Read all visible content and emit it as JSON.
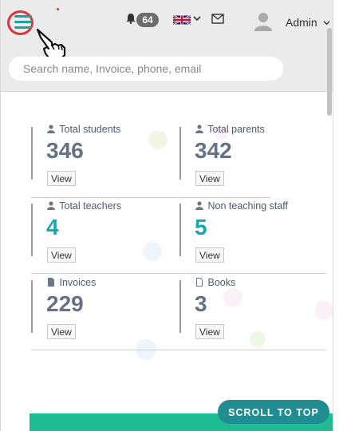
{
  "header": {
    "notification_count": "64",
    "user_name": "Admin",
    "dropdown_caret": "⌵"
  },
  "search": {
    "placeholder": "Search name, Invoice, phone, email"
  },
  "stats": [
    {
      "label": "Total students",
      "value": "346",
      "view_label": "View",
      "icon": "user-icon",
      "value_color": "#637287"
    },
    {
      "label": "Total parents",
      "value": "342",
      "view_label": "View",
      "icon": "user-icon",
      "value_color": "#637287"
    },
    {
      "label": "Total teachers",
      "value": "4",
      "view_label": "View",
      "icon": "user-icon",
      "value_color": "#14a9b0"
    },
    {
      "label": "Non teaching staff",
      "value": "5",
      "view_label": "View",
      "icon": "user-icon",
      "value_color": "#14a9b0"
    },
    {
      "label": "Invoices",
      "value": "229",
      "view_label": "View",
      "icon": "file-icon",
      "value_color": "#637287"
    },
    {
      "label": "Books",
      "value": "3",
      "view_label": "View",
      "icon": "file-outline-icon",
      "value_color": "#637287"
    }
  ],
  "scroll_top_label": "SCROLL TO TOP",
  "colors": {
    "accent_teal": "#14a9b0",
    "badge_gray": "#6d6d6d",
    "scroll_button": "#1f8d91",
    "highlight_ring": "#e0343a"
  }
}
